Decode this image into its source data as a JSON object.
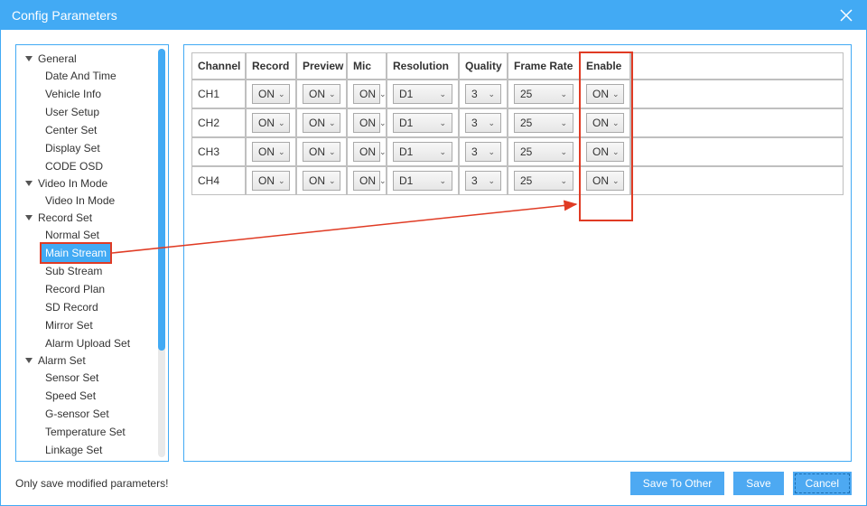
{
  "window": {
    "title": "Config Parameters"
  },
  "sidebar": {
    "groups": [
      {
        "label": "General",
        "items": [
          {
            "label": "Date And Time"
          },
          {
            "label": "Vehicle Info"
          },
          {
            "label": "User Setup"
          },
          {
            "label": "Center Set"
          },
          {
            "label": "Display Set"
          },
          {
            "label": "CODE OSD"
          }
        ]
      },
      {
        "label": "Video In Mode",
        "items": [
          {
            "label": "Video In Mode"
          }
        ]
      },
      {
        "label": "Record Set",
        "items": [
          {
            "label": "Normal Set"
          },
          {
            "label": "Main Stream",
            "selected": true,
            "highlighted": true
          },
          {
            "label": "Sub Stream"
          },
          {
            "label": "Record Plan"
          },
          {
            "label": "SD Record"
          },
          {
            "label": "Mirror Set"
          },
          {
            "label": "Alarm Upload Set"
          }
        ]
      },
      {
        "label": "Alarm Set",
        "items": [
          {
            "label": "Sensor Set"
          },
          {
            "label": "Speed Set"
          },
          {
            "label": "G-sensor Set"
          },
          {
            "label": "Temperature Set"
          },
          {
            "label": "Linkage Set"
          }
        ]
      }
    ]
  },
  "table": {
    "headers": {
      "channel": "Channel",
      "record": "Record",
      "preview": "Preview",
      "mic": "Mic",
      "resolution": "Resolution",
      "quality": "Quality",
      "framerate": "Frame Rate",
      "enable": "Enable"
    },
    "rows": [
      {
        "channel": "CH1",
        "record": "ON",
        "preview": "ON",
        "mic": "ON",
        "resolution": "D1",
        "quality": "3",
        "framerate": "25",
        "enable": "ON"
      },
      {
        "channel": "CH2",
        "record": "ON",
        "preview": "ON",
        "mic": "ON",
        "resolution": "D1",
        "quality": "3",
        "framerate": "25",
        "enable": "ON"
      },
      {
        "channel": "CH3",
        "record": "ON",
        "preview": "ON",
        "mic": "ON",
        "resolution": "D1",
        "quality": "3",
        "framerate": "25",
        "enable": "ON"
      },
      {
        "channel": "CH4",
        "record": "ON",
        "preview": "ON",
        "mic": "ON",
        "resolution": "D1",
        "quality": "3",
        "framerate": "25",
        "enable": "ON"
      }
    ]
  },
  "footer": {
    "note": "Only save modified parameters!",
    "save_to_other": "Save To Other",
    "save": "Save",
    "cancel": "Cancel"
  },
  "colors": {
    "accent": "#42aaf4",
    "highlight_box": "#e03b24"
  }
}
